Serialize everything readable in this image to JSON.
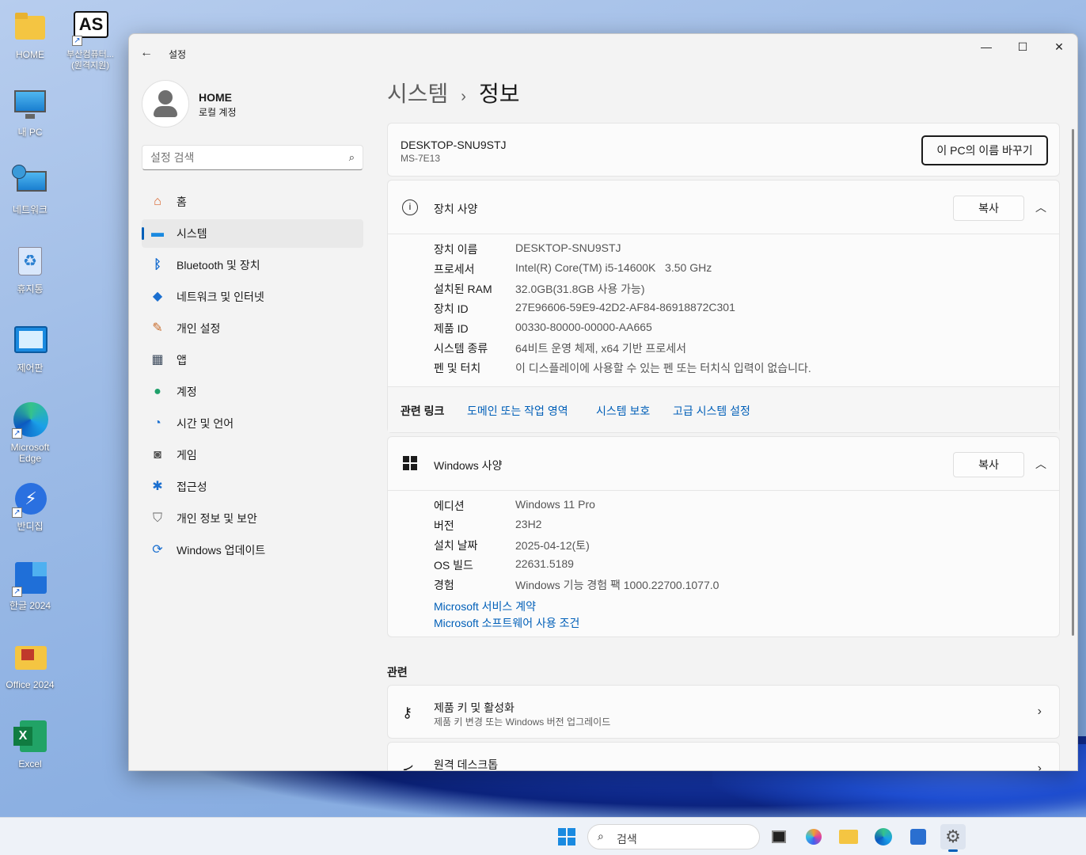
{
  "desktop": {
    "icons": [
      {
        "label": "HOME"
      },
      {
        "label": "부산컴퓨터... (원격지원)",
        "badge": "AS"
      },
      {
        "label": "내 PC"
      },
      {
        "label": "네트워크"
      },
      {
        "label": "휴지통"
      },
      {
        "label": "제어판"
      },
      {
        "label": "Microsoft Edge"
      },
      {
        "label": "반디집"
      },
      {
        "label": "한글 2024"
      },
      {
        "label": "Office 2024"
      },
      {
        "label": "Excel"
      }
    ]
  },
  "window": {
    "title": "설정",
    "profile": {
      "name": "HOME",
      "type": "로컬 계정"
    },
    "search_placeholder": "설정 검색",
    "nav": [
      {
        "label": "홈",
        "icon": "home-icon"
      },
      {
        "label": "시스템",
        "icon": "system-icon",
        "active": true
      },
      {
        "label": "Bluetooth 및 장치",
        "icon": "bluetooth-icon"
      },
      {
        "label": "네트워크 및 인터넷",
        "icon": "wifi-icon"
      },
      {
        "label": "개인 설정",
        "icon": "brush-icon"
      },
      {
        "label": "앱",
        "icon": "apps-icon"
      },
      {
        "label": "계정",
        "icon": "account-icon"
      },
      {
        "label": "시간 및 언어",
        "icon": "clock-globe-icon"
      },
      {
        "label": "게임",
        "icon": "gamepad-icon"
      },
      {
        "label": "접근성",
        "icon": "accessibility-icon"
      },
      {
        "label": "개인 정보 및 보안",
        "icon": "shield-icon"
      },
      {
        "label": "Windows 업데이트",
        "icon": "update-icon"
      }
    ],
    "breadcrumb": {
      "parent": "시스템",
      "separator": "›",
      "current": "정보"
    },
    "pc": {
      "name": "DESKTOP-SNU9STJ",
      "model": "MS-7E13",
      "rename_label": "이 PC의 이름 바꾸기"
    },
    "device_spec": {
      "title": "장치 사양",
      "copy_label": "복사",
      "rows": [
        {
          "key": "장치 이름",
          "value": "DESKTOP-SNU9STJ"
        },
        {
          "key": "프로세서",
          "value": "Intel(R) Core(TM) i5-14600K   3.50 GHz"
        },
        {
          "key": "설치된 RAM",
          "value": "32.0GB(31.8GB 사용 가능)"
        },
        {
          "key": "장치 ID",
          "value": "27E96606-59E9-42D2-AF84-86918872C301"
        },
        {
          "key": "제품 ID",
          "value": "00330-80000-00000-AA665"
        },
        {
          "key": "시스템 종류",
          "value": "64비트 운영 체제, x64 기반 프로세서"
        },
        {
          "key": "펜 및 터치",
          "value": "이 디스플레이에 사용할 수 있는 펜 또는 터치식 입력이 없습니다."
        }
      ]
    },
    "related_links": {
      "title": "관련 링크",
      "links": [
        "도메인 또는 작업 영역",
        "시스템 보호",
        "고급 시스템 설정"
      ]
    },
    "windows_spec": {
      "title": "Windows 사양",
      "copy_label": "복사",
      "rows": [
        {
          "key": "에디션",
          "value": "Windows 11 Pro"
        },
        {
          "key": "버전",
          "value": "23H2"
        },
        {
          "key": "설치 날짜",
          "value": "2025-04-12(토)"
        },
        {
          "key": "OS 빌드",
          "value": "22631.5189"
        },
        {
          "key": "경험",
          "value": "Windows 기능 경험 팩 1000.22700.1077.0"
        }
      ],
      "links": [
        "Microsoft 서비스 계약",
        "Microsoft 소프트웨어 사용 조건"
      ]
    },
    "related": {
      "title": "관련",
      "items": [
        {
          "title": "제품 키 및 활성화",
          "subtitle": "제품 키 변경 또는 Windows 버전 업그레이드"
        },
        {
          "title": "원격 데스크톱",
          "subtitle": ""
        }
      ]
    }
  },
  "taskbar": {
    "search_label": "검색"
  },
  "colors": {
    "accent": "#005fb8",
    "window_bg": "#f3f3f3",
    "card_bg": "#fbfbfb"
  }
}
